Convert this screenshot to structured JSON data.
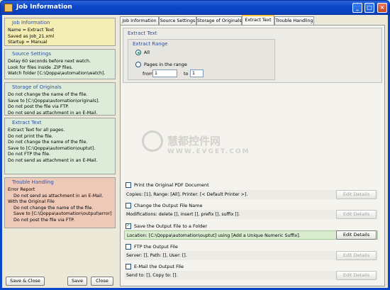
{
  "window": {
    "title": "Job Information",
    "minimize_label": "_",
    "maximize_label": "□",
    "close_label": "×"
  },
  "left": {
    "info": {
      "title": "Job Information",
      "lines": [
        "Name = Extract Text",
        "Saved as Job_21.xml",
        "Startup = Manual"
      ]
    },
    "source": {
      "title": "Source Settings",
      "lines": [
        "Delay 60 seconds before next watch.",
        "Look for files inside .ZIP files.",
        "Watch folder [C:\\Qoppa\\automation\\watch]."
      ]
    },
    "originals": {
      "title": "Storage of Originals",
      "lines": [
        "Do not change the name of the file.",
        "Save to [C:\\Qoppa\\automation\\originals].",
        "Do not post the file via FTP.",
        "Do not send as attachment in an E-Mail."
      ]
    },
    "extract": {
      "title": "Extract Text",
      "lines": [
        "Extract Text for all pages.",
        "Do not print the file.",
        "Do not change the name of the file.",
        "Save to [C:\\Qoppa\\automation\\ouptut].",
        "Do not FTP the file.",
        "Do not send as attachment in an E-Mail."
      ]
    },
    "trouble": {
      "title": "Trouble Handling",
      "lines": [
        "Error Report",
        "Do not send as attachment in an E-Mail.",
        "With the Original File",
        "Do not change the name of the file.",
        "Save to [C:\\Qoppa\\automation\\output\\error].",
        "Do not post the file via FTP."
      ]
    },
    "buttons": {
      "save_close": "Save & Close",
      "save": "Save",
      "close": "Close"
    }
  },
  "tabs": [
    "Job Information",
    "Source Settings",
    "Storage of Originals",
    "Extract Text",
    "Trouble Handling"
  ],
  "active_tab": "Extract Text",
  "extract_panel": {
    "group_title": "Extract Text",
    "range_title": "Extract Range",
    "opt_all": "All",
    "opt_pages": "Pages in the range",
    "from_label": "from",
    "from_value": "1",
    "to_label": "to",
    "to_value": "1"
  },
  "watermark": {
    "cn": "慧都控件网",
    "en": "WWW.EVGET.COM"
  },
  "outputs": [
    {
      "label": "Print the Original PDF Document",
      "checked": false,
      "detail": "Copies: [1], Range: [All], Printer: [< Default Printer >].",
      "button": "Edit Details",
      "enabled": false
    },
    {
      "label": "Change the Output File Name",
      "checked": false,
      "detail": "Modifications: delete [], insert [], prefix [], suffix [].",
      "button": "Edit Details",
      "enabled": false
    },
    {
      "label": "Save the Output File to a Folder",
      "checked": true,
      "detail": "Location: [C:\\Qoppa\\automation\\ouptut] using [Add a Unique Numeric Suffix].",
      "button": "Edit Details",
      "enabled": true
    },
    {
      "label": "FTP the Output File",
      "checked": false,
      "detail": "Server: [], Path: [], User: [].",
      "button": "Edit Details",
      "enabled": false
    },
    {
      "label": "E-Mail the Output File",
      "checked": false,
      "detail": "Send to: [], Copy to: [].",
      "button": "Edit Details",
      "enabled": false
    }
  ],
  "colors": {
    "titlebar": "#0a46c8",
    "info_bg": "#f4eeb4",
    "green_bg": "#dcecd8",
    "trouble_bg": "#efc9b8",
    "section_title": "#3050a0"
  }
}
